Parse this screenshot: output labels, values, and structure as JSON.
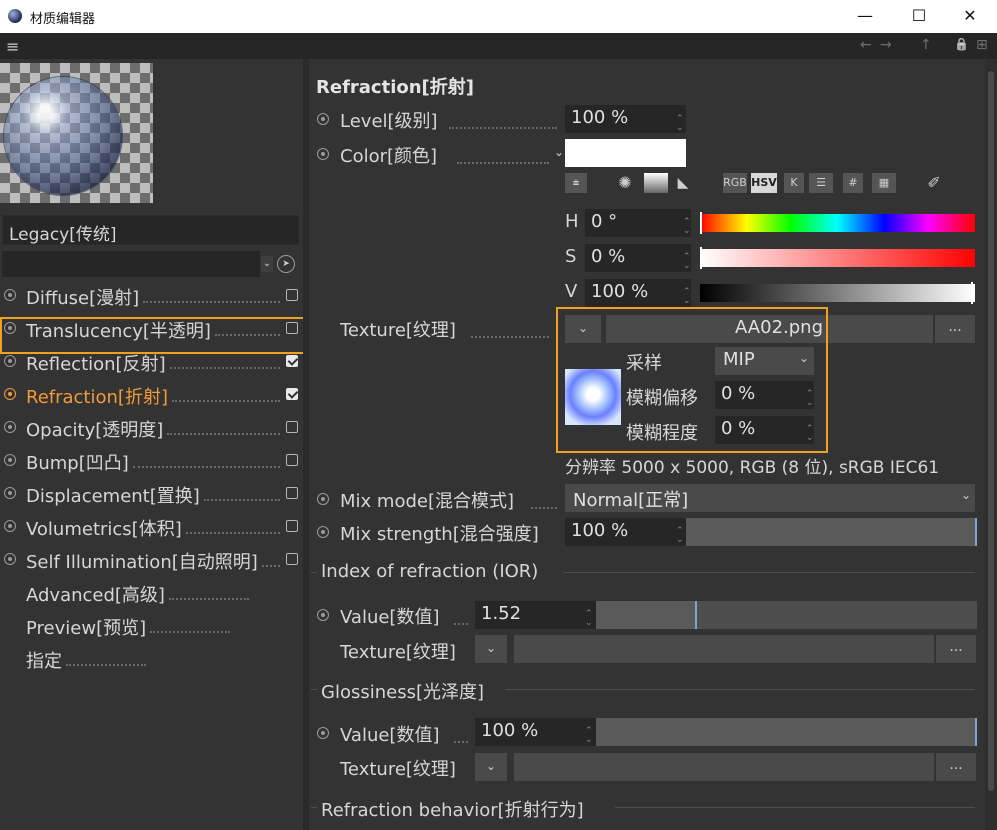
{
  "window": {
    "title": "材质编辑器",
    "min_label": "—",
    "max_label": "☐",
    "close_label": "✕"
  },
  "toolbar": {
    "menu_icon": "≡",
    "back_icon": "←",
    "forward_icon": "→",
    "up_icon": "↑",
    "lock_icon": "🔒",
    "newwin_icon": "⊞"
  },
  "left": {
    "preset": "Legacy[传统]",
    "channels": [
      {
        "label": "Diffuse[漫射]",
        "checked": false,
        "has_checkbox": true,
        "has_radio": true
      },
      {
        "label": "Translucency[半透明]",
        "checked": false,
        "has_checkbox": true,
        "has_radio": true
      },
      {
        "label": "Reflection[反射]",
        "checked": true,
        "has_checkbox": true,
        "has_radio": true
      },
      {
        "label": "Refraction[折射]",
        "checked": true,
        "has_checkbox": true,
        "has_radio": true,
        "active": true
      },
      {
        "label": "Opacity[透明度]",
        "checked": false,
        "has_checkbox": true,
        "has_radio": true
      },
      {
        "label": "Bump[凹凸]",
        "checked": false,
        "has_checkbox": true,
        "has_radio": true
      },
      {
        "label": "Displacement[置换]",
        "checked": false,
        "has_checkbox": true,
        "has_radio": true
      },
      {
        "label": "Volumetrics[体积]",
        "checked": false,
        "has_checkbox": true,
        "has_radio": true
      },
      {
        "label": "Self Illumination[自动照明]",
        "checked": false,
        "has_checkbox": true,
        "has_radio": true
      },
      {
        "label": "Advanced[高级]",
        "has_checkbox": false,
        "has_radio": false
      },
      {
        "label": "Preview[预览]",
        "has_checkbox": false,
        "has_radio": false
      },
      {
        "label": "指定",
        "has_checkbox": false,
        "has_radio": false
      }
    ],
    "accent_color": "#f29b38"
  },
  "right": {
    "section_title": "Refraction[折射]",
    "level": {
      "label": "Level[级别]",
      "value": "100 %"
    },
    "color": {
      "label": "Color[颜色]",
      "swatch": "#ffffff",
      "modes": [
        "RGB",
        "HSV",
        "K",
        "☰",
        "#",
        "▦"
      ],
      "h": {
        "label": "H",
        "value": "0 °",
        "level": 0.0
      },
      "s": {
        "label": "S",
        "value": "0 %",
        "level": 0.0
      },
      "v": {
        "label": "V",
        "value": "100 %",
        "level": 1.0
      }
    },
    "texture": {
      "label": "Texture[纹理]",
      "file": "AA02.png",
      "more": "...",
      "sampling_label": "采样",
      "sampling_value": "MIP",
      "blur_offset_label": "模糊偏移",
      "blur_offset_value": "0 %",
      "blur_scale_label": "模糊程度",
      "blur_scale_value": "0 %",
      "info": "分辨率 5000 x 5000, RGB (8 位), sRGB IEC61"
    },
    "mix_mode": {
      "label": "Mix mode[混合模式]",
      "value": "Normal[正常]"
    },
    "mix_strength": {
      "label": "Mix strength[混合强度]",
      "value": "100 %",
      "level": 1.0
    },
    "ior": {
      "group": "Index of refraction (IOR)",
      "value_label": "Value[数值]",
      "value": "1.52",
      "level": 0.26,
      "texture_label": "Texture[纹理]",
      "more": "..."
    },
    "gloss": {
      "group": "Glossiness[光泽度]",
      "value_label": "Value[数值]",
      "value": "100 %",
      "level": 1.0,
      "texture_label": "Texture[纹理]",
      "more": "..."
    },
    "behavior_group": "Refraction behavior[折射行为]"
  },
  "highlight_color": "#f0a21f"
}
